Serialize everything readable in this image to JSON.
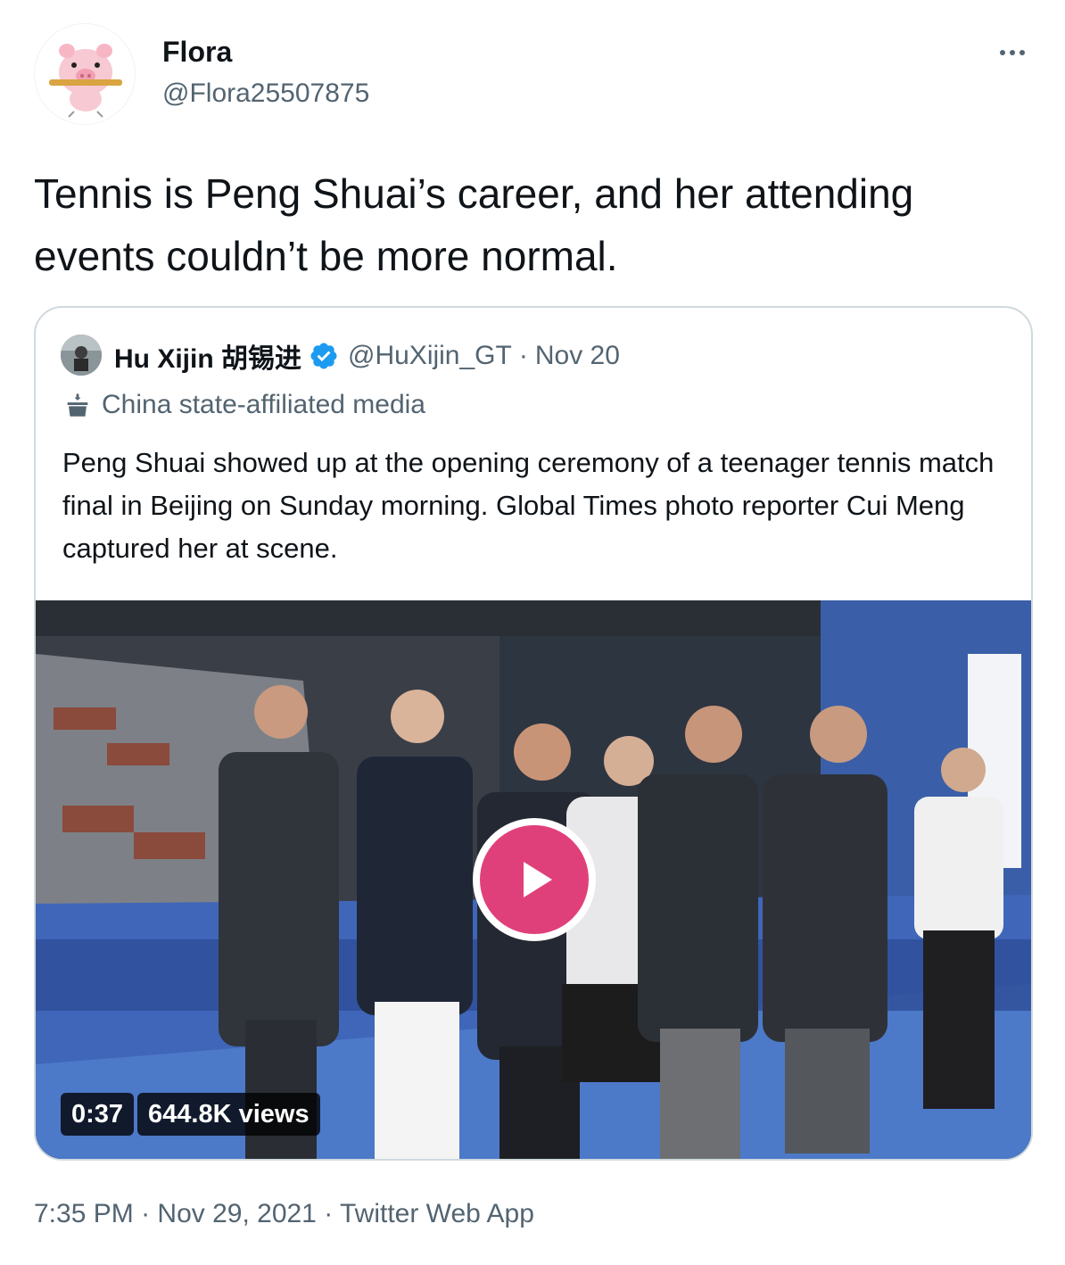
{
  "author": {
    "display_name": "Flora",
    "handle": "@Flora25507875",
    "avatar_icon": "pig-cartoon-avatar-icon"
  },
  "tweet": {
    "text": "Tennis is Peng Shuai’s career, and her attending events couldn’t be more normal."
  },
  "quoted_tweet": {
    "display_name": "Hu Xijin 胡锡进",
    "handle": "@HuXijin_GT",
    "separator": "·",
    "date": "Nov 20",
    "label": "China state-affiliated media",
    "text": "Peng Shuai showed up at the opening ceremony of a teenager tennis match final in Beijing on Sunday morning. Global Times photo reporter Cui Meng captured her at scene.",
    "media": {
      "duration": "0:37",
      "views": "644.8K views",
      "play_icon": "play-icon",
      "play_color": "#e0407a"
    }
  },
  "footer": {
    "time": "7:35 PM",
    "separator1": " · ",
    "date": "Nov 29, 2021",
    "separator2": " · ",
    "source": "Twitter Web App"
  },
  "colors": {
    "text_primary": "#0f1419",
    "text_secondary": "#536471",
    "border": "#cfd9de",
    "verified": "#1d9bf0"
  }
}
